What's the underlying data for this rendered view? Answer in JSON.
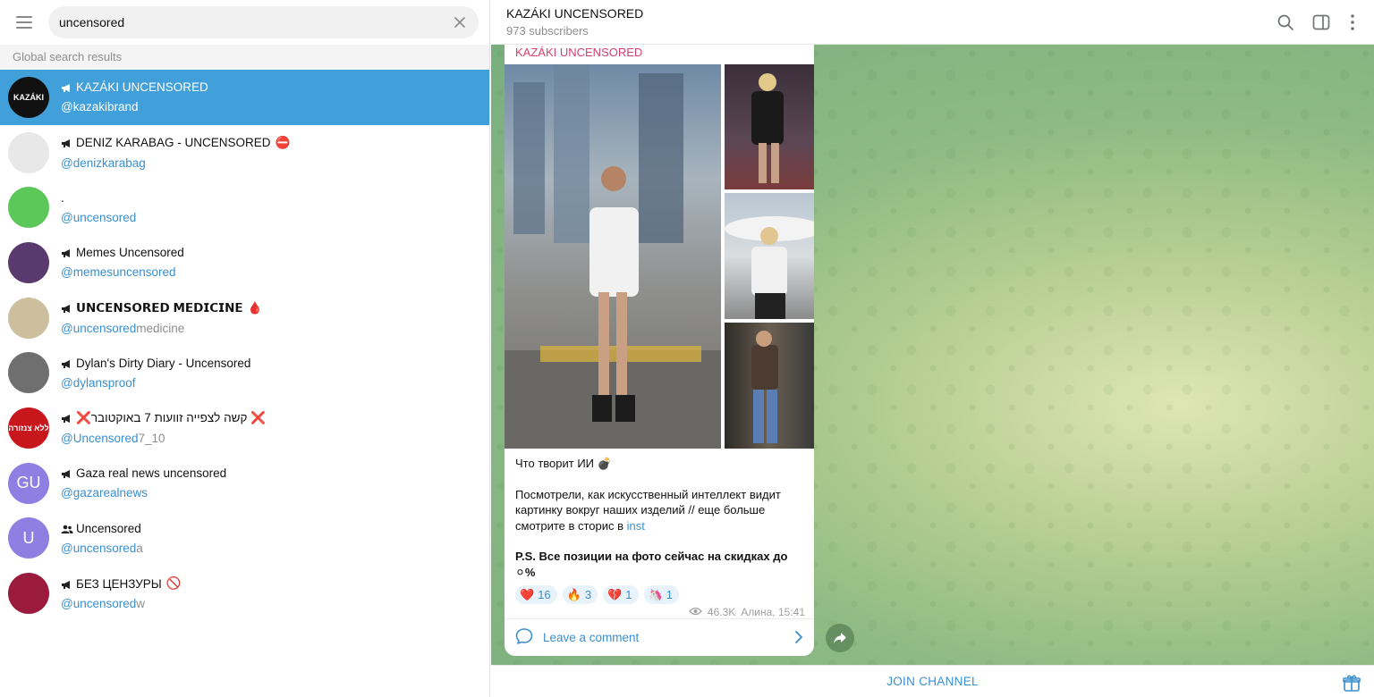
{
  "search": {
    "value": "uncensored"
  },
  "section_header": "Global search results",
  "results": [
    {
      "title": "KAZÁKI UNCENSORED",
      "user": "@kazakibrand",
      "user_rest": "",
      "avatar_text": "KAZÁKI",
      "avatar_color": "#111111",
      "type": "channel",
      "emoji": ""
    },
    {
      "title": "DENIZ KARABAG - UNCENSORED",
      "user": "@denizkarabag",
      "user_rest": "",
      "avatar_text": "",
      "avatar_color": "#e8e8e8",
      "type": "channel",
      "emoji": "⛔"
    },
    {
      "title": ".",
      "user": "@uncensored",
      "user_rest": "",
      "avatar_text": "",
      "avatar_color": "#5cc85a",
      "type": "none",
      "emoji": ""
    },
    {
      "title": "Memes Uncensored",
      "user": "@memesuncensored",
      "user_rest": "",
      "avatar_text": "",
      "avatar_color": "#5a3a6e",
      "type": "channel",
      "emoji": ""
    },
    {
      "title": "𝗨𝗡𝗖𝗘𝗡𝗦𝗢𝗥𝗘𝗗 𝗠𝗘𝗗𝗜𝗖𝗜𝗡𝗘",
      "user": "@uncensored",
      "user_rest": "medicine",
      "avatar_text": "",
      "avatar_color": "#cdbf9e",
      "type": "channel",
      "emoji": "🩸"
    },
    {
      "title": "Dylan's Dirty Diary - Uncensored",
      "user": "@dylansproof",
      "user_rest": "",
      "avatar_text": "",
      "avatar_color": "#6f6f6f",
      "type": "channel",
      "emoji": ""
    },
    {
      "title": "❌קשה לצפייה זוועות 7 באוקטובר ❌",
      "user": "@Uncensored",
      "user_rest": "7_10",
      "avatar_text": "ללא צנזורה",
      "avatar_color": "#c8161d",
      "type": "channel",
      "emoji": ""
    },
    {
      "title": "Gaza real news uncensored",
      "user": "@gazarealnews",
      "user_rest": "",
      "avatar_text": "GU",
      "avatar_color": "#8f7fe3",
      "type": "channel",
      "emoji": ""
    },
    {
      "title": "Uncensored",
      "user": "@uncensored",
      "user_rest": "a",
      "avatar_text": "U",
      "avatar_color": "#8f7fe3",
      "type": "group",
      "emoji": ""
    },
    {
      "title": "БЕЗ ЦЕНЗУРЫ",
      "user": "@uncensored",
      "user_rest": "w",
      "avatar_text": "",
      "avatar_color": "#9b1b3c",
      "type": "channel",
      "emoji": "🚫"
    }
  ],
  "chat": {
    "title": "KAZÁKI UNCENSORED",
    "subscribers": "973 subscribers",
    "post": {
      "author": "KAZÁKI UNCENSORED",
      "line1": "Что творит ИИ 💣",
      "para1": "Посмотрели, как искусственный интеллект видит картинку вокруг наших изделий // еще больше смотрите в сторис в",
      "link": "inst",
      "ps": "P.S. Все позиции на фото сейчас на скидках до ⚪%",
      "reactions": [
        {
          "emoji": "❤️",
          "count": "16"
        },
        {
          "emoji": "🔥",
          "count": "3"
        },
        {
          "emoji": "💔",
          "count": "1"
        },
        {
          "emoji": "🦄",
          "count": "1"
        }
      ],
      "views": "46.3K",
      "signature": "Алина, 15:41",
      "comment_label": "Leave a comment"
    },
    "join_label": "JOIN CHANNEL"
  },
  "colors": {
    "accent": "#419fd9",
    "link": "#3a8fd0",
    "author": "#d3416e"
  },
  "icons": [
    "menu-icon",
    "clear-icon",
    "search-icon",
    "sidebar-toggle-icon",
    "more-icon",
    "eye-icon",
    "comment-icon",
    "chevron-right-icon",
    "share-icon",
    "gift-icon"
  ]
}
